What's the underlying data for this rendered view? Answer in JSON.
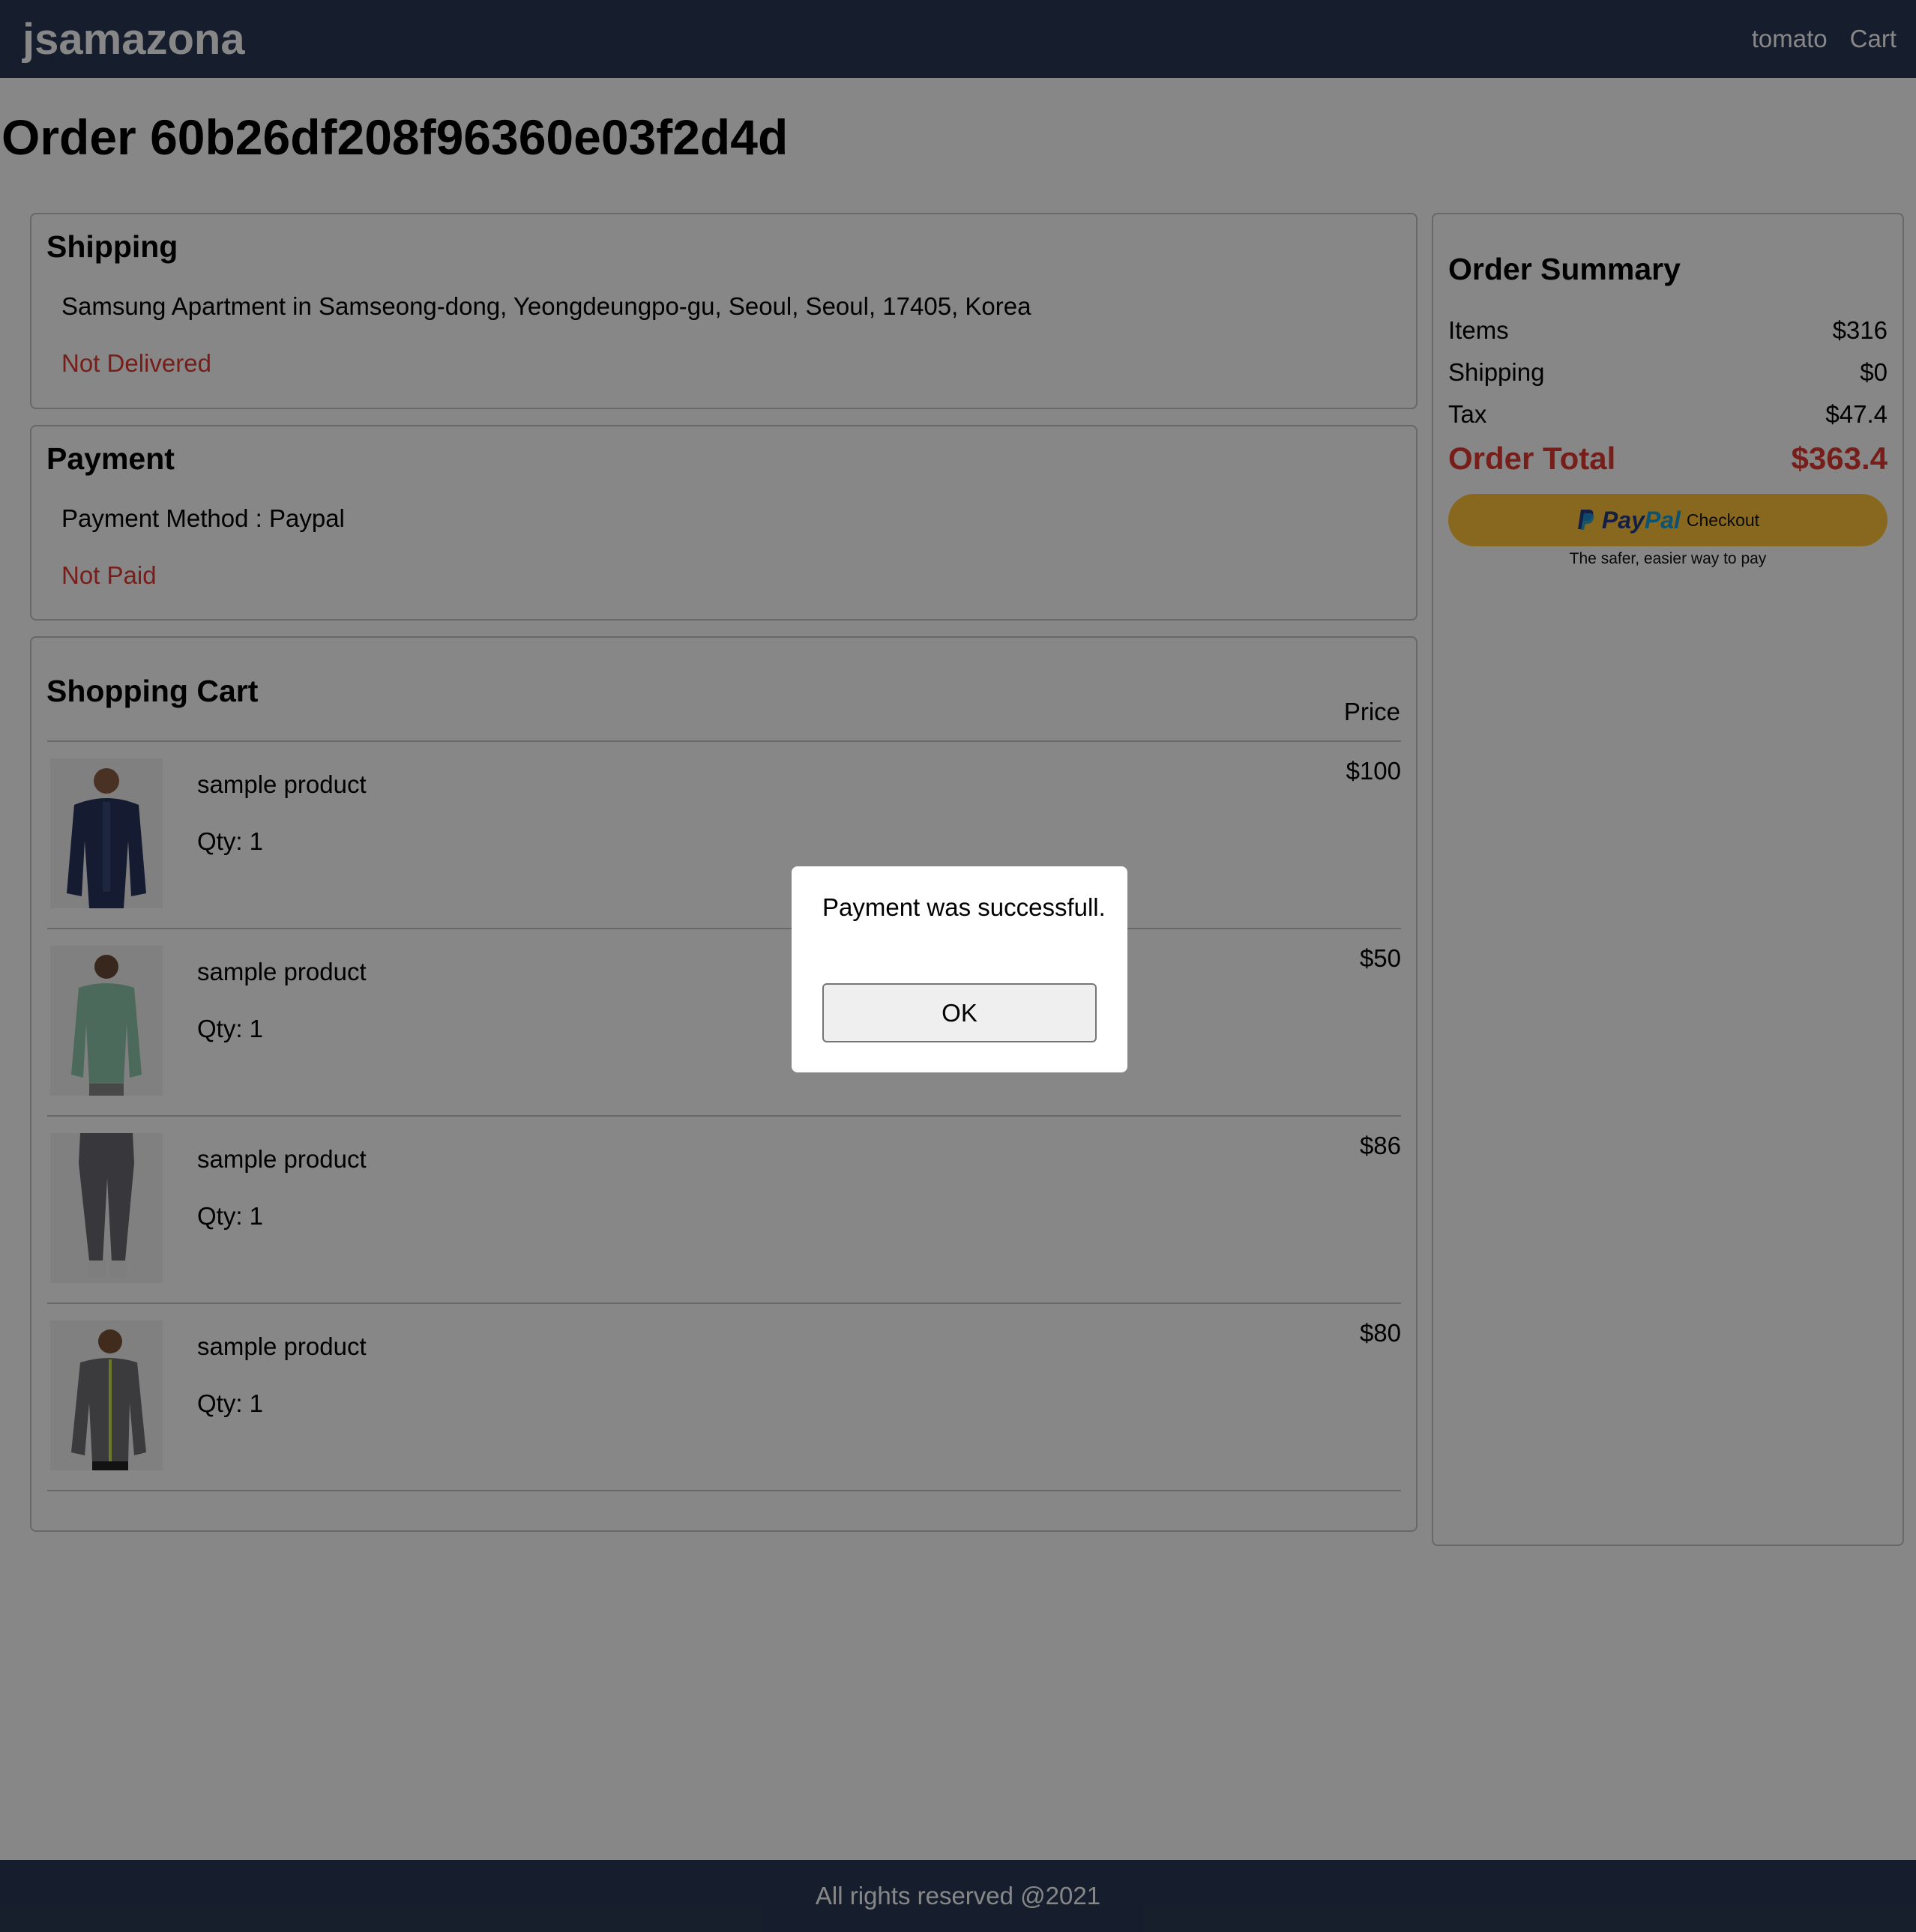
{
  "header": {
    "brand": "jsamazona",
    "nav": {
      "user": "tomato",
      "cart": "Cart"
    }
  },
  "order": {
    "title": "Order 60b26df208f96360e03f2d4d"
  },
  "shipping": {
    "heading": "Shipping",
    "address": "Samsung Apartment in Samseong-dong, Yeongdeungpo-gu, Seoul, Seoul, 17405, Korea",
    "status": "Not Delivered"
  },
  "payment": {
    "heading": "Payment",
    "method": "Payment Method : Paypal",
    "status": "Not Paid"
  },
  "cart": {
    "heading": "Shopping Cart",
    "price_header": "Price",
    "items": [
      {
        "name": "sample product",
        "qty": "Qty: 1",
        "price": "$100",
        "image": "navy-hoodie"
      },
      {
        "name": "sample product",
        "qty": "Qty: 1",
        "price": "$50",
        "image": "green-sweater"
      },
      {
        "name": "sample product",
        "qty": "Qty: 1",
        "price": "$86",
        "image": "gray-joggers"
      },
      {
        "name": "sample product",
        "qty": "Qty: 1",
        "price": "$80",
        "image": "gray-track-jacket"
      }
    ]
  },
  "summary": {
    "heading": "Order Summary",
    "rows": [
      {
        "label": "Items",
        "value": "$316"
      },
      {
        "label": "Shipping",
        "value": "$0"
      },
      {
        "label": "Tax",
        "value": "$47.4"
      }
    ],
    "total": {
      "label": "Order Total",
      "value": "$363.4"
    },
    "paypal": {
      "brand_pay": "Pay",
      "brand_pal": "Pal",
      "checkout": "Checkout",
      "tagline": "The safer, easier way to pay"
    }
  },
  "footer": {
    "text": "All rights reserved @2021"
  },
  "dialog": {
    "message": "Payment was successfull.",
    "ok": "OK"
  },
  "colors": {
    "header_bg": "#2b3a55",
    "status_red": "#e03a31",
    "paypal_yellow": "#ffc439"
  }
}
